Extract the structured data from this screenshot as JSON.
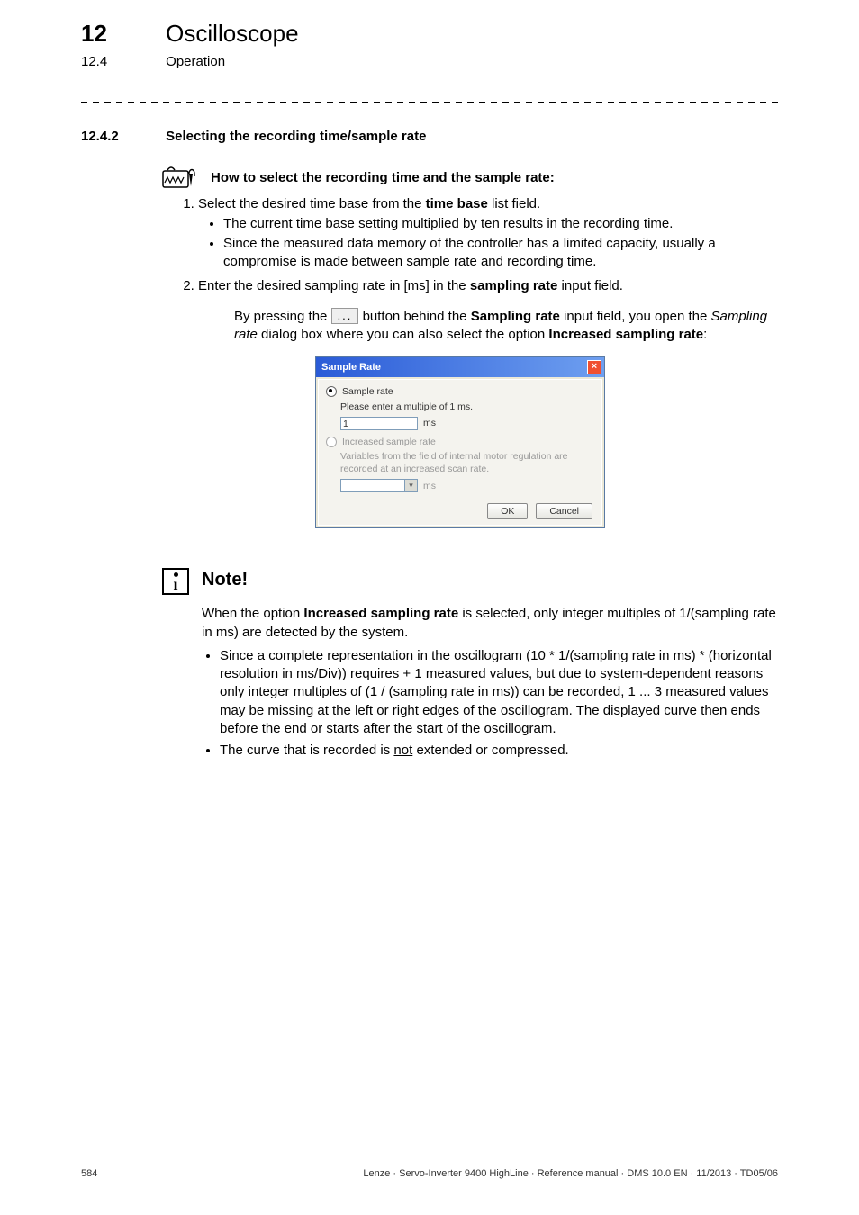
{
  "header": {
    "chapter_num": "12",
    "chapter_title": "Oscilloscope",
    "sub_num": "12.4",
    "sub_title": "Operation"
  },
  "section": {
    "num": "12.4.2",
    "title": "Selecting the recording time/sample rate"
  },
  "howto": {
    "text": "How to select the recording time and the sample rate:"
  },
  "steps": {
    "s1": "Select the desired time base from the ",
    "s1_b": "time base",
    "s1_tail": " list field.",
    "s1_sub1": "The current time base setting multiplied by ten results in the recording time.",
    "s1_sub2": "Since the measured data memory of the controller has a limited capacity, usually a compromise is made between sample rate and recording time.",
    "s2": "Enter the desired sampling rate in [ms] in the ",
    "s2_b": "sampling rate",
    "s2_tail": " input field."
  },
  "para": {
    "p1_a": "By pressing the ",
    "btn_glyph": "...",
    "p1_b": " button behind the ",
    "p1_b1": "Sampling rate",
    "p1_c": " input field, you open the ",
    "p1_i": "Sampling rate",
    "p1_d": " dialog box where you can also select the option ",
    "p1_b2": "Increased sampling rate",
    "p1_e": ":"
  },
  "dialog": {
    "title": "Sample Rate",
    "opt1": "Sample rate",
    "opt1_desc": "Please enter a multiple of 1 ms.",
    "opt1_value": "1",
    "unit": "ms",
    "opt2": "Increased sample rate",
    "opt2_desc": "Variables from the field of internal motor regulation are recorded at an increased scan rate.",
    "ok": "OK",
    "cancel": "Cancel"
  },
  "note": {
    "title": "Note!",
    "p1_a": "When the option ",
    "p1_b": "Increased sampling rate",
    "p1_c": " is selected, only integer multiples of 1/(sampling rate in ms) are detected by the system.",
    "li1": "Since a complete representation in the oscillogram (10 * 1/(sampling rate in ms) * (horizontal resolution in ms/Div)) requires + 1 measured values, but due to system-dependent reasons only integer multiples of (1 / (sampling rate in ms)) can be recorded, 1 ... 3 measured values may be missing at the left or right edges of the oscillogram. The displayed curve then ends before the end or starts after the start of the oscillogram.",
    "li2_a": "The curve that is recorded is ",
    "li2_u": "not",
    "li2_b": " extended or compressed."
  },
  "footer": {
    "page": "584",
    "info": "Lenze · Servo-Inverter 9400 HighLine · Reference manual · DMS 10.0 EN · 11/2013 · TD05/06"
  }
}
